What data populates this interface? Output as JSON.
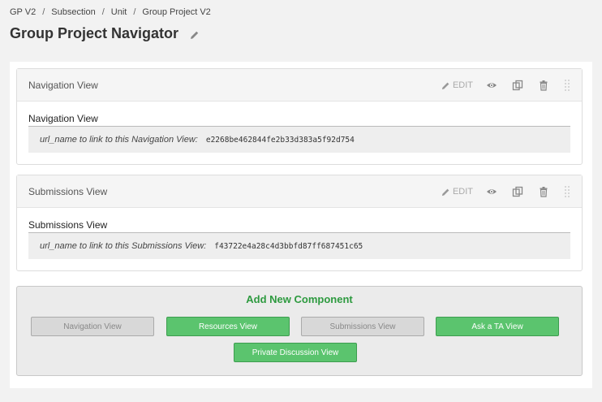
{
  "breadcrumb": [
    "GP V2",
    "Subsection",
    "Unit",
    "Group Project V2"
  ],
  "breadcrumb_separator": "/",
  "page_title": "Group Project Navigator",
  "blocks": [
    {
      "header_title": "Navigation View",
      "edit_label": "EDIT",
      "content_title": "Navigation View",
      "url_label": "url_name to link to this Navigation View:",
      "url_value": "e2268be462844fe2b33d383a5f92d754"
    },
    {
      "header_title": "Submissions View",
      "edit_label": "EDIT",
      "content_title": "Submissions View",
      "url_label": "url_name to link to this Submissions View:",
      "url_value": "f43722e4a28c4d3bbfd87ff687451c65"
    }
  ],
  "add_component": {
    "title": "Add New Component",
    "buttons": [
      {
        "label": "Navigation View",
        "state": "disabled"
      },
      {
        "label": "Resources View",
        "state": "enabled"
      },
      {
        "label": "Submissions View",
        "state": "disabled"
      },
      {
        "label": "Ask a TA View",
        "state": "enabled"
      },
      {
        "label": "Private Discussion View",
        "state": "enabled"
      }
    ]
  },
  "colors": {
    "accent_green": "#2d9a3f",
    "button_green": "#5bc46e",
    "button_grey": "#d8d8d8"
  },
  "icons": [
    "pencil-icon",
    "eye-icon",
    "duplicate-icon",
    "trash-icon",
    "drag-handle-icon"
  ]
}
